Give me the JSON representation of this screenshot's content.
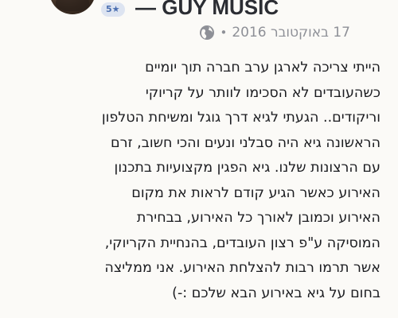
{
  "post": {
    "rating_badge": "5★",
    "page_name": "— GUY MUSIC",
    "date": "17 באוקטובר 2016",
    "separator": "•",
    "privacy_icon": "globe-icon",
    "body_lines": [
      "הייתי צריכה לארגן ערב חברה תוך יומיים",
      "כשהעובדים לא הסכימו לוותר על קריוקי",
      "וריקודים.. הגעתי לגיא דרך גוגל ומשיחת הטלפון",
      "הראשונה גיא היה סבלני ונעים והכי חשוב, זרם",
      "עם הרצונות שלנו. גיא הפגין מקצועיות בתכנון",
      "האירוע כאשר הגיע קודם לראות את מקום",
      "האירוע וכמובן לאורך כל האירוע, בבחירת",
      "המוסיקה ע\"פ רצון העובדים, בהנחיית הקריוקי,",
      "אשר תרמו רבות להצלחת האירוע. אני ממליצה",
      "בחום על גיא באירוע הבא שלכם :-)"
    ]
  },
  "colors": {
    "background": "#fbfaf7",
    "text": "#1b1c20",
    "meta": "#8e9097",
    "badge_bg": "#dde4f1",
    "badge_text": "#4b6fb0"
  }
}
